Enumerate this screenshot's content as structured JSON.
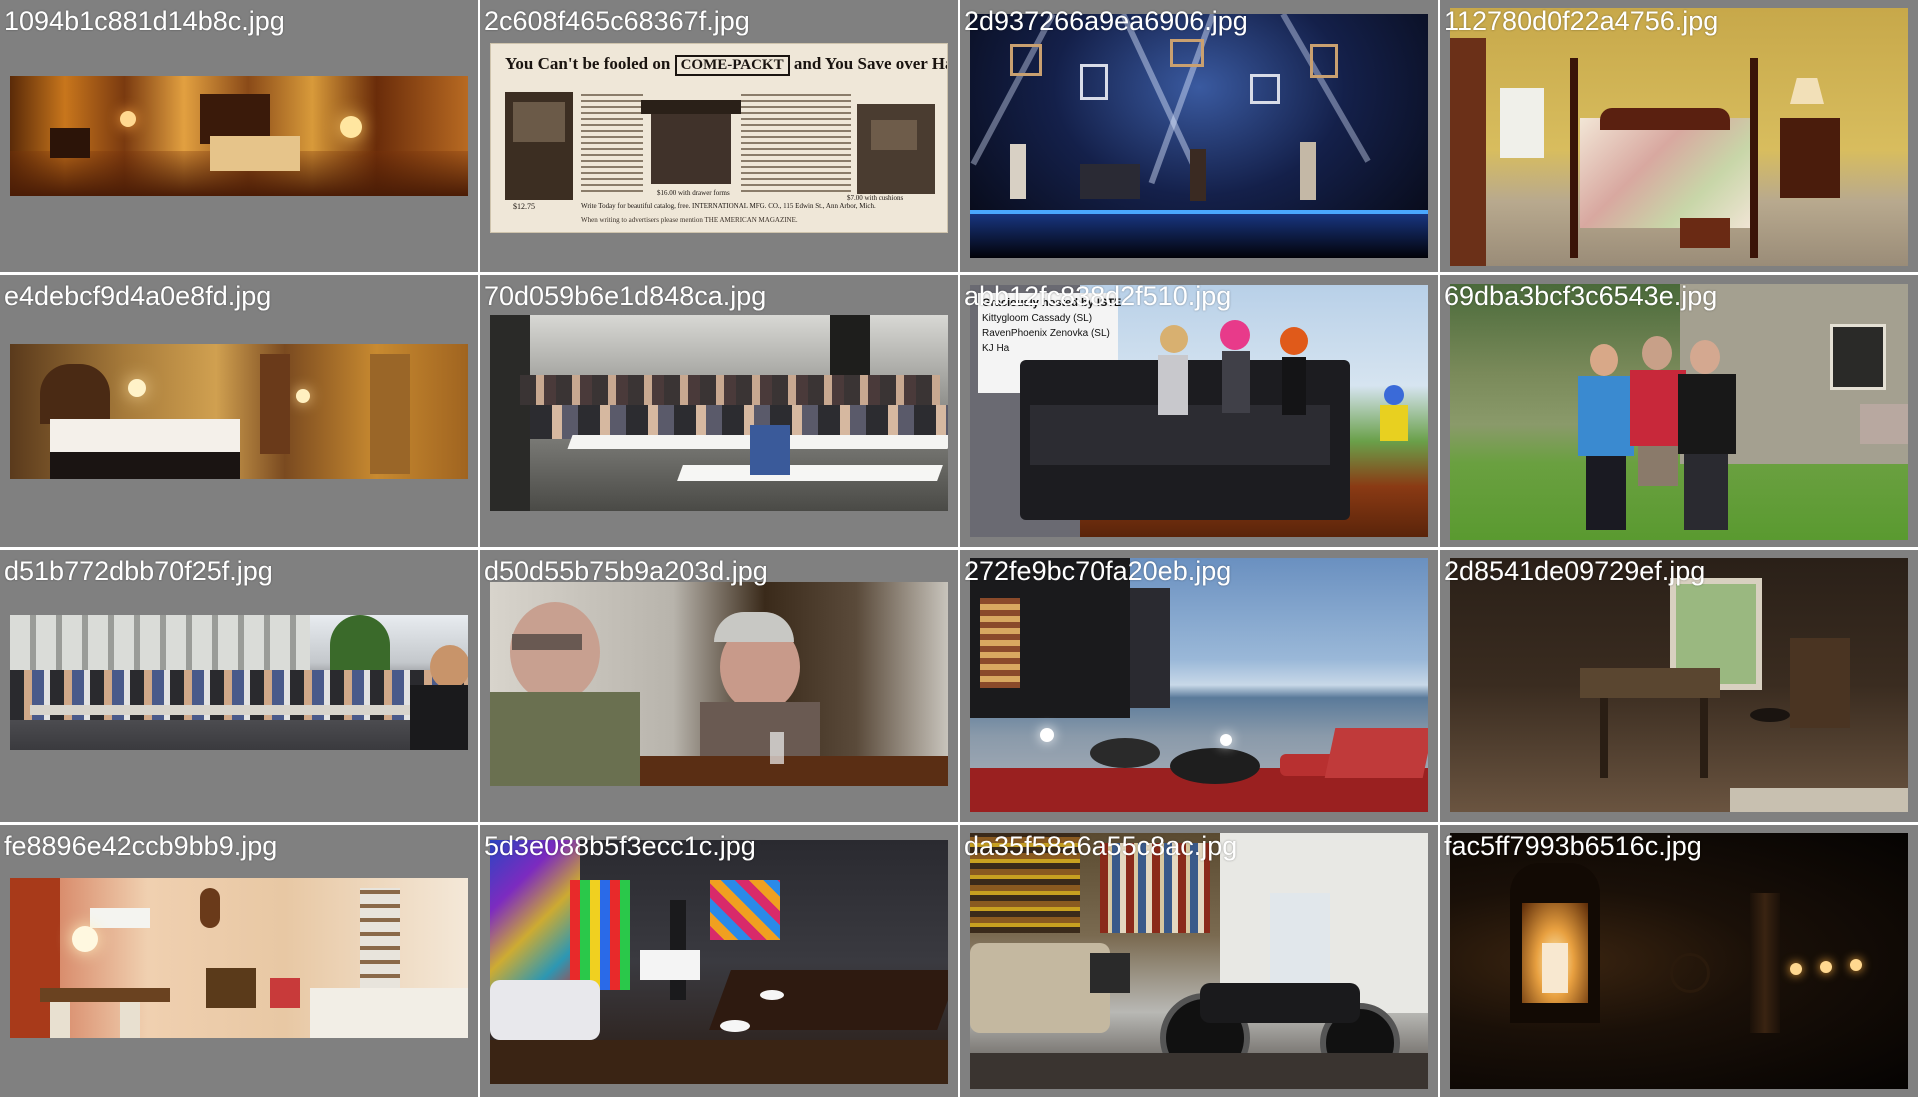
{
  "gallery": {
    "tiles": [
      {
        "filename": "1094b1c881d14b8c.jpg",
        "subject": "hotel room panorama"
      },
      {
        "filename": "2c608f465c68367f.jpg",
        "subject": "vintage furniture advertisement",
        "ad": {
          "headline_left": "You Can't be fooled on",
          "brand": "COME-PACKT",
          "headline_right": "and You Save over Half",
          "price_1": "$12.75",
          "price_2": "$16.00 with drawer forms",
          "price_3": "$7.00 with cushions",
          "footer": "Write Today for beautiful catalog, free. INTERNATIONAL MFG. CO., 115 Edwin St., Ann Arbor, Mich.",
          "bottom_note": "When writing to advertisers please mention THE AMERICAN MAGAZINE."
        }
      },
      {
        "filename": "2d937266a9ea6906.jpg",
        "subject": "concert stage with band"
      },
      {
        "filename": "112780d0f22a4756.jpg",
        "subject": "bedroom with four-poster bed"
      },
      {
        "filename": "e4debcf9d4a0e8fd.jpg",
        "subject": "hotel room with bed"
      },
      {
        "filename": "70d059b6e1d848ca.jpg",
        "subject": "classroom seminar"
      },
      {
        "filename": "abb12fc838d2f510.jpg",
        "subject": "virtual world avatars on sofa",
        "sign": {
          "line1": "Graciously hosted by ISTE",
          "line2": "Kittygloom Cassady (SL)",
          "line3": "RavenPhoenix Zenovka (SL)",
          "line4": "KJ Ha"
        }
      },
      {
        "filename": "69dba3bcf3c6543e.jpg",
        "subject": "three people in front of cottage"
      },
      {
        "filename": "d51b772dbb70f25f.jpg",
        "subject": "outdoor cafe crowd"
      },
      {
        "filename": "d50d55b75b9a203d.jpg",
        "subject": "two people at restaurant table"
      },
      {
        "filename": "272fe9bc70fa20eb.jpg",
        "subject": "terrace lounge overlooking sea"
      },
      {
        "filename": "2d8541de09729ef.jpg",
        "subject": "rustic interior with desk"
      },
      {
        "filename": "fe8896e42ccb9bb9.jpg",
        "subject": "living room with dining table"
      },
      {
        "filename": "5d3e088b5f3ecc1c.jpg",
        "subject": "colorful bar lounge"
      },
      {
        "filename": "da35f58a6a55c8ac.jpg",
        "subject": "motorcycle in garage"
      },
      {
        "filename": "fac5ff7993b6516c.jpg",
        "subject": "candle lantern at night"
      }
    ]
  },
  "colors": {
    "tile_background": "#808080",
    "caption_text": "#ffffff",
    "gutter": "#ffffff"
  }
}
